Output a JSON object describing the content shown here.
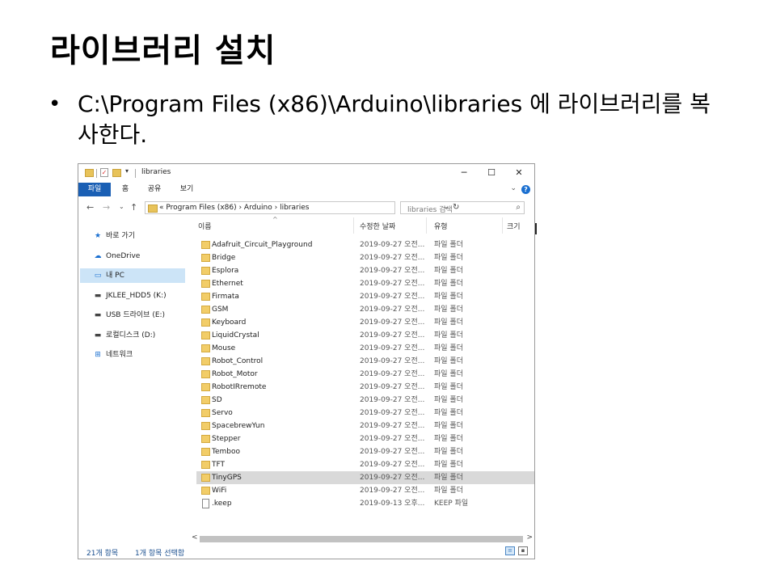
{
  "slide": {
    "title": "라이브러리 설치",
    "bullet": "•",
    "bullet_text": "C:\\Program Files (x86)\\Arduino\\libraries 에 라이브러리를 복사한다."
  },
  "explorer": {
    "window_title": "libraries",
    "window_buttons": {
      "minimize": "─",
      "maximize": "☐",
      "close": "✕"
    },
    "ribbon_tabs": [
      "파일",
      "홈",
      "공유",
      "보기"
    ],
    "address": {
      "path_text": "«  Program Files (x86)  ›  Arduino  ›  libraries",
      "search_placeholder": "libraries 검색"
    },
    "columns": {
      "name": "이름",
      "date": "수정한 날짜",
      "type": "유형",
      "size": "크기"
    },
    "nav_items": [
      {
        "label": "바로 가기",
        "icon": "★",
        "selected": false
      },
      {
        "label": "OneDrive",
        "icon": "☁",
        "selected": false
      },
      {
        "label": "내 PC",
        "icon": "▭",
        "selected": true
      },
      {
        "label": "JKLEE_HDD5 (K:)",
        "icon": "▬",
        "selected": false
      },
      {
        "label": "USB 드라이브 (E:)",
        "icon": "▬",
        "selected": false
      },
      {
        "label": "로컬디스크 (D:)",
        "icon": "▬",
        "selected": false
      },
      {
        "label": "네트워크",
        "icon": "⊞",
        "selected": false
      }
    ],
    "files": [
      {
        "name": "Adafruit_Circuit_Playground",
        "date": "2019-09-27 오전...",
        "type": "파일 폴더",
        "kind": "folder"
      },
      {
        "name": "Bridge",
        "date": "2019-09-27 오전...",
        "type": "파일 폴더",
        "kind": "folder"
      },
      {
        "name": "Esplora",
        "date": "2019-09-27 오전...",
        "type": "파일 폴더",
        "kind": "folder"
      },
      {
        "name": "Ethernet",
        "date": "2019-09-27 오전...",
        "type": "파일 폴더",
        "kind": "folder"
      },
      {
        "name": "Firmata",
        "date": "2019-09-27 오전...",
        "type": "파일 폴더",
        "kind": "folder"
      },
      {
        "name": "GSM",
        "date": "2019-09-27 오전...",
        "type": "파일 폴더",
        "kind": "folder"
      },
      {
        "name": "Keyboard",
        "date": "2019-09-27 오전...",
        "type": "파일 폴더",
        "kind": "folder"
      },
      {
        "name": "LiquidCrystal",
        "date": "2019-09-27 오전...",
        "type": "파일 폴더",
        "kind": "folder"
      },
      {
        "name": "Mouse",
        "date": "2019-09-27 오전...",
        "type": "파일 폴더",
        "kind": "folder"
      },
      {
        "name": "Robot_Control",
        "date": "2019-09-27 오전...",
        "type": "파일 폴더",
        "kind": "folder"
      },
      {
        "name": "Robot_Motor",
        "date": "2019-09-27 오전...",
        "type": "파일 폴더",
        "kind": "folder"
      },
      {
        "name": "RobotIRremote",
        "date": "2019-09-27 오전...",
        "type": "파일 폴더",
        "kind": "folder"
      },
      {
        "name": "SD",
        "date": "2019-09-27 오전...",
        "type": "파일 폴더",
        "kind": "folder"
      },
      {
        "name": "Servo",
        "date": "2019-09-27 오전...",
        "type": "파일 폴더",
        "kind": "folder"
      },
      {
        "name": "SpacebrewYun",
        "date": "2019-09-27 오전...",
        "type": "파일 폴더",
        "kind": "folder"
      },
      {
        "name": "Stepper",
        "date": "2019-09-27 오전...",
        "type": "파일 폴더",
        "kind": "folder"
      },
      {
        "name": "Temboo",
        "date": "2019-09-27 오전...",
        "type": "파일 폴더",
        "kind": "folder"
      },
      {
        "name": "TFT",
        "date": "2019-09-27 오전...",
        "type": "파일 폴더",
        "kind": "folder"
      },
      {
        "name": "TinyGPS",
        "date": "2019-09-27 오전...",
        "type": "파일 폴더",
        "kind": "folder",
        "selected": true
      },
      {
        "name": "WiFi",
        "date": "2019-09-27 오전...",
        "type": "파일 폴더",
        "kind": "folder"
      },
      {
        "name": ".keep",
        "date": "2019-09-13 오후...",
        "type": "KEEP 파일",
        "kind": "file"
      }
    ],
    "status": {
      "item_count": "21개 항목",
      "selected_count": "1개 항목 선택함"
    },
    "colors": {
      "accent": "#1a5fb4",
      "selection": "#cce4f7",
      "folder": "#f2cd68"
    }
  }
}
